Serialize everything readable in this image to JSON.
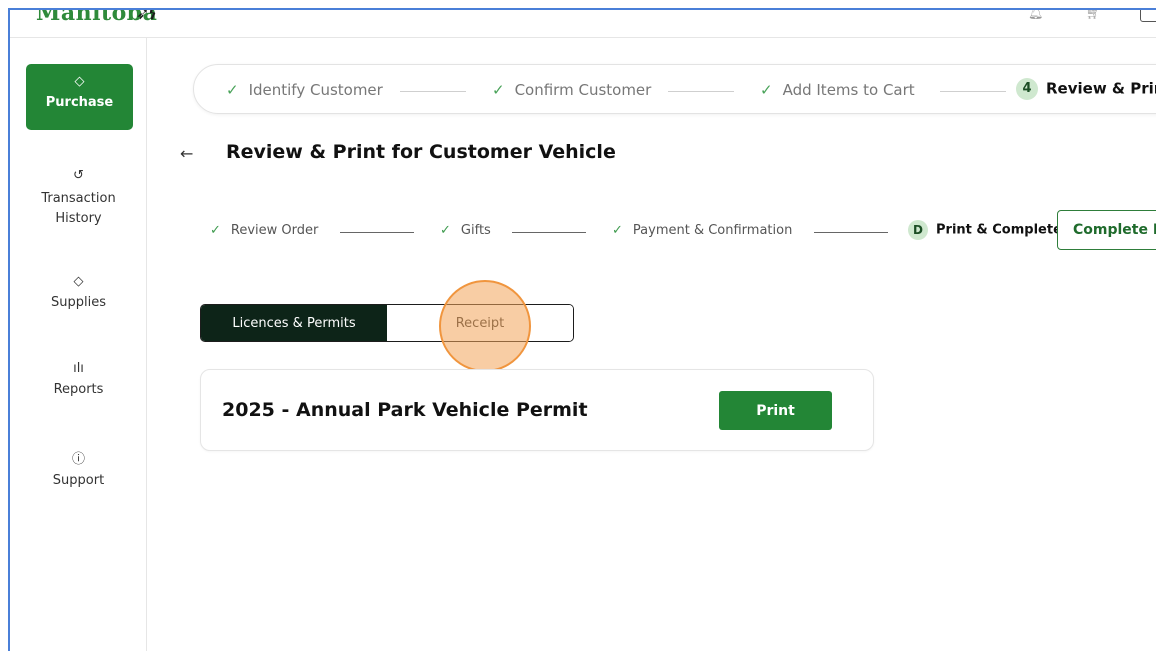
{
  "header": {
    "logo_text": "Manitoba",
    "bell_icon": "bell-icon",
    "cart_icon": "cart-icon"
  },
  "sidebar": {
    "items": [
      {
        "label": "Purchase",
        "icon": "tag-icon",
        "active": true
      },
      {
        "label": "Transaction History",
        "icon": "history-icon",
        "active": false
      },
      {
        "label": "Supplies",
        "icon": "tag-outline-icon",
        "active": false
      },
      {
        "label": "Reports",
        "icon": "bar-chart-icon",
        "active": false
      },
      {
        "label": "Support",
        "icon": "help-circle-icon",
        "active": false
      }
    ]
  },
  "stepper": {
    "steps": [
      {
        "label": "Identify Customer",
        "state": "done"
      },
      {
        "label": "Confirm Customer",
        "state": "done"
      },
      {
        "label": "Add Items to Cart",
        "state": "done"
      },
      {
        "number": "4",
        "label": "Review & Print",
        "state": "active"
      }
    ]
  },
  "page": {
    "title": "Review & Print for Customer Vehicle"
  },
  "sub_stepper": {
    "steps": [
      {
        "label": "Review Order",
        "state": "done"
      },
      {
        "label": "Gifts",
        "state": "done"
      },
      {
        "label": "Payment & Confirmation",
        "state": "done"
      },
      {
        "number": "D",
        "label": "Print & Complete",
        "state": "active"
      }
    ],
    "complete_button": "Complete P"
  },
  "toggle": {
    "options": [
      "Licences & Permits",
      "Receipt"
    ],
    "selected": "Licences & Permits"
  },
  "permit_card": {
    "title": "2025 - Annual Park Vehicle Permit",
    "print_button": "Print"
  },
  "colors": {
    "brand_green": "#238636",
    "dark_green": "#0d2418",
    "check_green": "#4aa35a",
    "highlight_orange": "#f0953e"
  }
}
